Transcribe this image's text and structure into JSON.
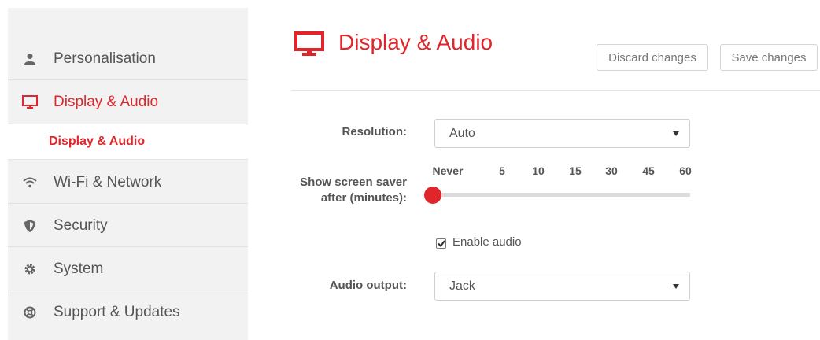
{
  "sidebar": {
    "items": [
      {
        "label": "Personalisation",
        "icon": "user-icon"
      },
      {
        "label": "Display & Audio",
        "icon": "monitor-icon",
        "active": true
      },
      {
        "label": "Wi-Fi & Network",
        "icon": "wifi-icon"
      },
      {
        "label": "Security",
        "icon": "shield-icon"
      },
      {
        "label": "System",
        "icon": "gear-icon"
      },
      {
        "label": "Support & Updates",
        "icon": "lifebuoy-icon"
      }
    ],
    "sub_item": {
      "label": "Display & Audio"
    }
  },
  "header": {
    "title": "Display & Audio",
    "discard_label": "Discard changes",
    "save_label": "Save changes"
  },
  "form": {
    "resolution": {
      "label": "Resolution:",
      "value": "Auto"
    },
    "screensaver": {
      "label_line1": "Show screen saver",
      "label_line2": "after (minutes):",
      "ticks": [
        "Never",
        "5",
        "10",
        "15",
        "30",
        "45",
        "60"
      ],
      "selected": "Never"
    },
    "enable_audio": {
      "label": "Enable audio",
      "checked": true
    },
    "audio_output": {
      "label": "Audio output:",
      "value": "Jack"
    }
  },
  "colors": {
    "accent": "#e0262a",
    "sidebar_bg": "#f2f2f2"
  }
}
